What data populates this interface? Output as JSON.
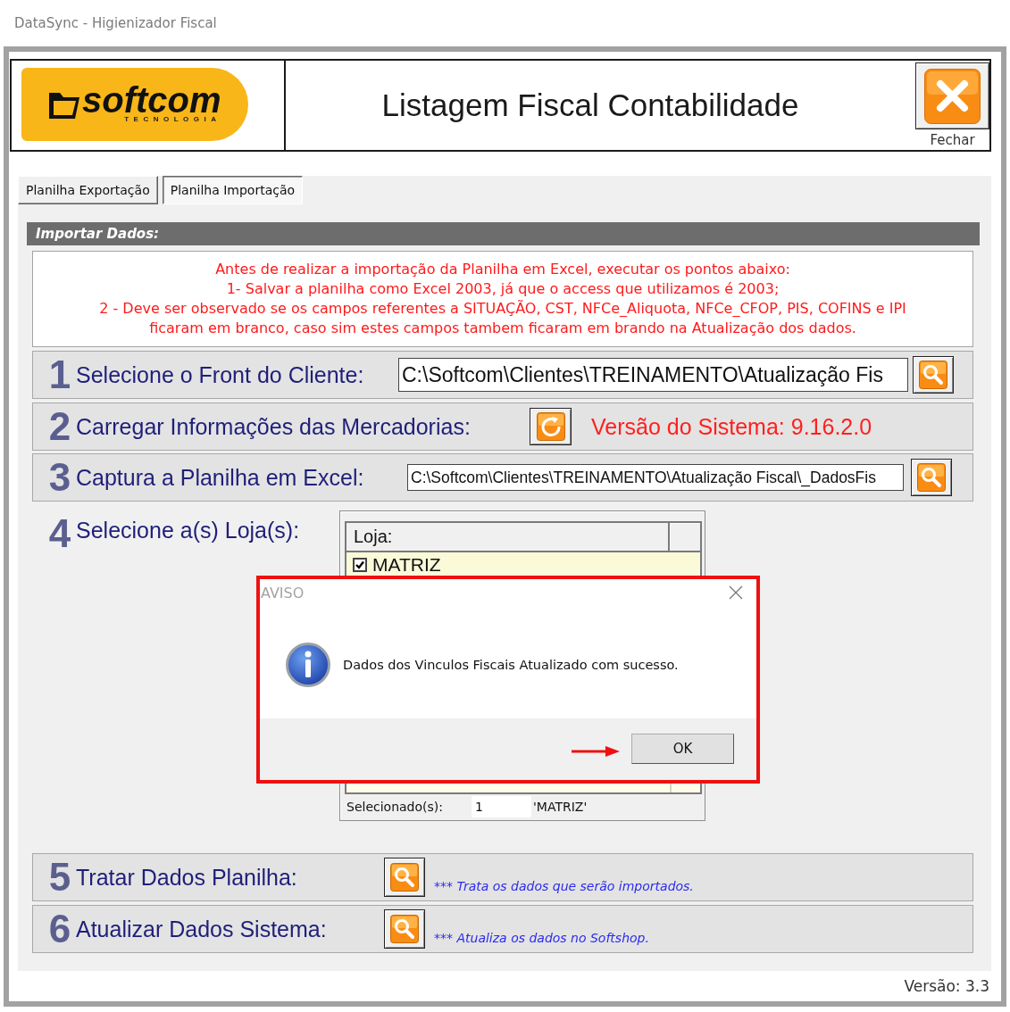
{
  "window": {
    "title": "DataSync - Higienizador Fiscal"
  },
  "header": {
    "logo": {
      "text": "softcom",
      "tagline": "TECNOLOGIA"
    },
    "title": "Listagem Fiscal Contabilidade",
    "close_label": "Fechar"
  },
  "tabs": [
    {
      "label": "Planilha Exportação",
      "selected": false
    },
    {
      "label": "Planilha Importação",
      "selected": true
    }
  ],
  "section": {
    "title": "Importar Dados:",
    "notice": [
      "Antes de realizar a importação da Planilha em Excel, executar os pontos abaixo:",
      "1- Salvar a planilha como Excel 2003, já que o access que utilizamos é 2003;",
      "2 - Deve ser observado se os campos referentes a SITUAÇÃO, CST, NFCe_Aliquota, NFCe_CFOP, PIS, COFINS e IPI",
      "ficaram em branco, caso sim estes campos tambem ficaram em brando na Atualização dos dados."
    ]
  },
  "steps": [
    {
      "kind": "front",
      "number": "1",
      "label": "Selecione o Front do Cliente:",
      "value": "C:\\Softcom\\Clientes\\TREINAMENTO\\Atualização Fis"
    },
    {
      "kind": "load",
      "number": "2",
      "label": "Carregar Informações das Mercadorias:",
      "status": "Versão do Sistema: 9.16.2.0"
    },
    {
      "kind": "file",
      "number": "3",
      "label": "Captura a Planilha em Excel:",
      "value": "C:\\Softcom\\Clientes\\TREINAMENTO\\Atualização Fiscal\\_DadosFis"
    },
    {
      "kind": "stores",
      "number": "4",
      "label": "Selecione a(s) Loja(s):",
      "grid": {
        "column": "Loja:",
        "rows": [
          {
            "name": "MATRIZ",
            "checked": true
          }
        ]
      },
      "selected_label": "Selecionado(s):",
      "selected_count": "1",
      "selected_names": "'MATRIZ'"
    },
    {
      "kind": "action",
      "number": "5",
      "label": "Tratar Dados Planilha:",
      "note": "*** Trata os dados que serão importados."
    },
    {
      "kind": "action",
      "number": "6",
      "label": "Atualizar Dados Sistema:",
      "note": "*** Atualiza os dados no Softshop."
    }
  ],
  "footer": {
    "version": "Versão: 3.3"
  },
  "dialog": {
    "title": "AVISO",
    "message": "Dados dos Vinculos Fiscais Atualizado com sucesso.",
    "button": "OK"
  }
}
